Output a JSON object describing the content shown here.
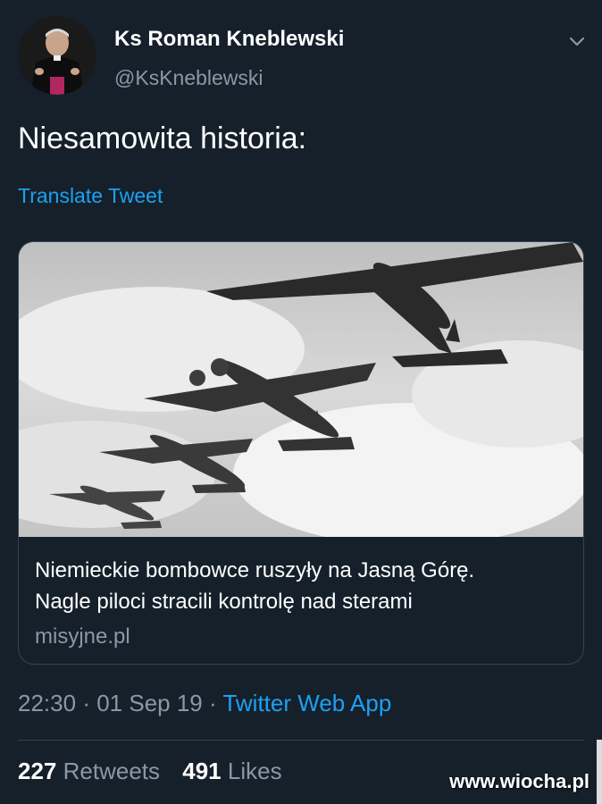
{
  "author": {
    "name": "Ks Roman Kneblewski",
    "handle": "@KsKneblewski"
  },
  "tweet": {
    "text": "Niesamowita historia:",
    "translate_label": "Translate Tweet"
  },
  "card": {
    "title_line1": "Niemieckie bombowce ruszyły na Jasną Górę.",
    "title_line2": "Nagle piloci stracili kontrolę nad sterami",
    "domain": "misyjne.pl"
  },
  "meta": {
    "time": "22:30",
    "separator": "·",
    "date": "01 Sep 19",
    "app": "Twitter Web App"
  },
  "stats": {
    "retweets_count": "227",
    "retweets_label": "Retweets",
    "likes_count": "491",
    "likes_label": "Likes"
  },
  "watermark": "www.wiocha.pl",
  "colors": {
    "background": "#15202b",
    "accent": "#1da1f2",
    "secondary_text": "#8899a6",
    "border": "#38444d"
  },
  "icons": {
    "menu": "chevron-down-icon"
  }
}
